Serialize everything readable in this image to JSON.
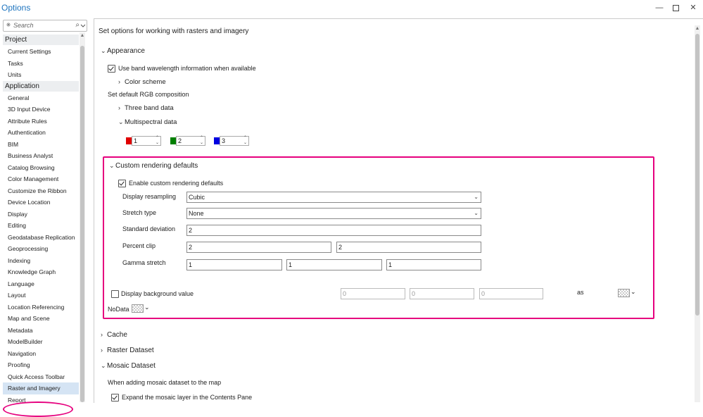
{
  "window": {
    "title": "Options"
  },
  "search": {
    "placeholder": "Search"
  },
  "nav": {
    "project_label": "Project",
    "project_items": [
      "Current Settings",
      "Tasks",
      "Units"
    ],
    "application_label": "Application",
    "application_items": [
      "General",
      "3D Input Device",
      "Attribute Rules",
      "Authentication",
      "BIM",
      "Business Analyst",
      "Catalog Browsing",
      "Color Management",
      "Customize the Ribbon",
      "Device Location",
      "Display",
      "Editing",
      "Geodatabase Replication",
      "Geoprocessing",
      "Indexing",
      "Knowledge Graph",
      "Language",
      "Layout",
      "Location Referencing",
      "Map and Scene",
      "Metadata",
      "ModelBuilder",
      "Navigation",
      "Proofing",
      "Quick Access Toolbar",
      "Raster and Imagery",
      "Report"
    ],
    "selected": "Raster and Imagery"
  },
  "main": {
    "description": "Set options for working with rasters and imagery",
    "appearance": {
      "label": "Appearance",
      "use_band_label": "Use band wavelength information when available",
      "use_band_checked": true,
      "color_scheme_label": "Color scheme",
      "rgb_label": "Set default RGB composition",
      "three_band_label": "Three band data",
      "multispectral_label": "Multispectral data",
      "bands": [
        {
          "value": "1",
          "color": "#e00000"
        },
        {
          "value": "2",
          "color": "#008000"
        },
        {
          "value": "3",
          "color": "#0000e0"
        }
      ]
    },
    "custom": {
      "label": "Custom rendering defaults",
      "enable_label": "Enable custom rendering defaults",
      "enable_checked": true,
      "resampling_label": "Display resampling",
      "resampling_value": "Cubic",
      "stretch_label": "Stretch type",
      "stretch_value": "None",
      "stddev_label": "Standard deviation",
      "stddev_value": "2",
      "pct_label": "Percent clip",
      "pct_values": [
        "2",
        "2"
      ],
      "gamma_label": "Gamma stretch",
      "gamma_values": [
        "1",
        "1",
        "1"
      ],
      "bg_label": "Display background value",
      "bg_checked": false,
      "bg_values": [
        "0",
        "0",
        "0"
      ],
      "as_label": "as",
      "nodata_label": "NoData"
    },
    "cache_label": "Cache",
    "raster_dataset_label": "Raster Dataset",
    "mosaic": {
      "label": "Mosaic Dataset",
      "when_adding_label": "When adding mosaic dataset to the map",
      "expand_label": "Expand the mosaic layer in the Contents Pane",
      "expand_checked": true
    }
  },
  "colors": {
    "highlight": "#e6007e",
    "selected_bg": "#d5e4f4",
    "title": "#1e74bf"
  }
}
